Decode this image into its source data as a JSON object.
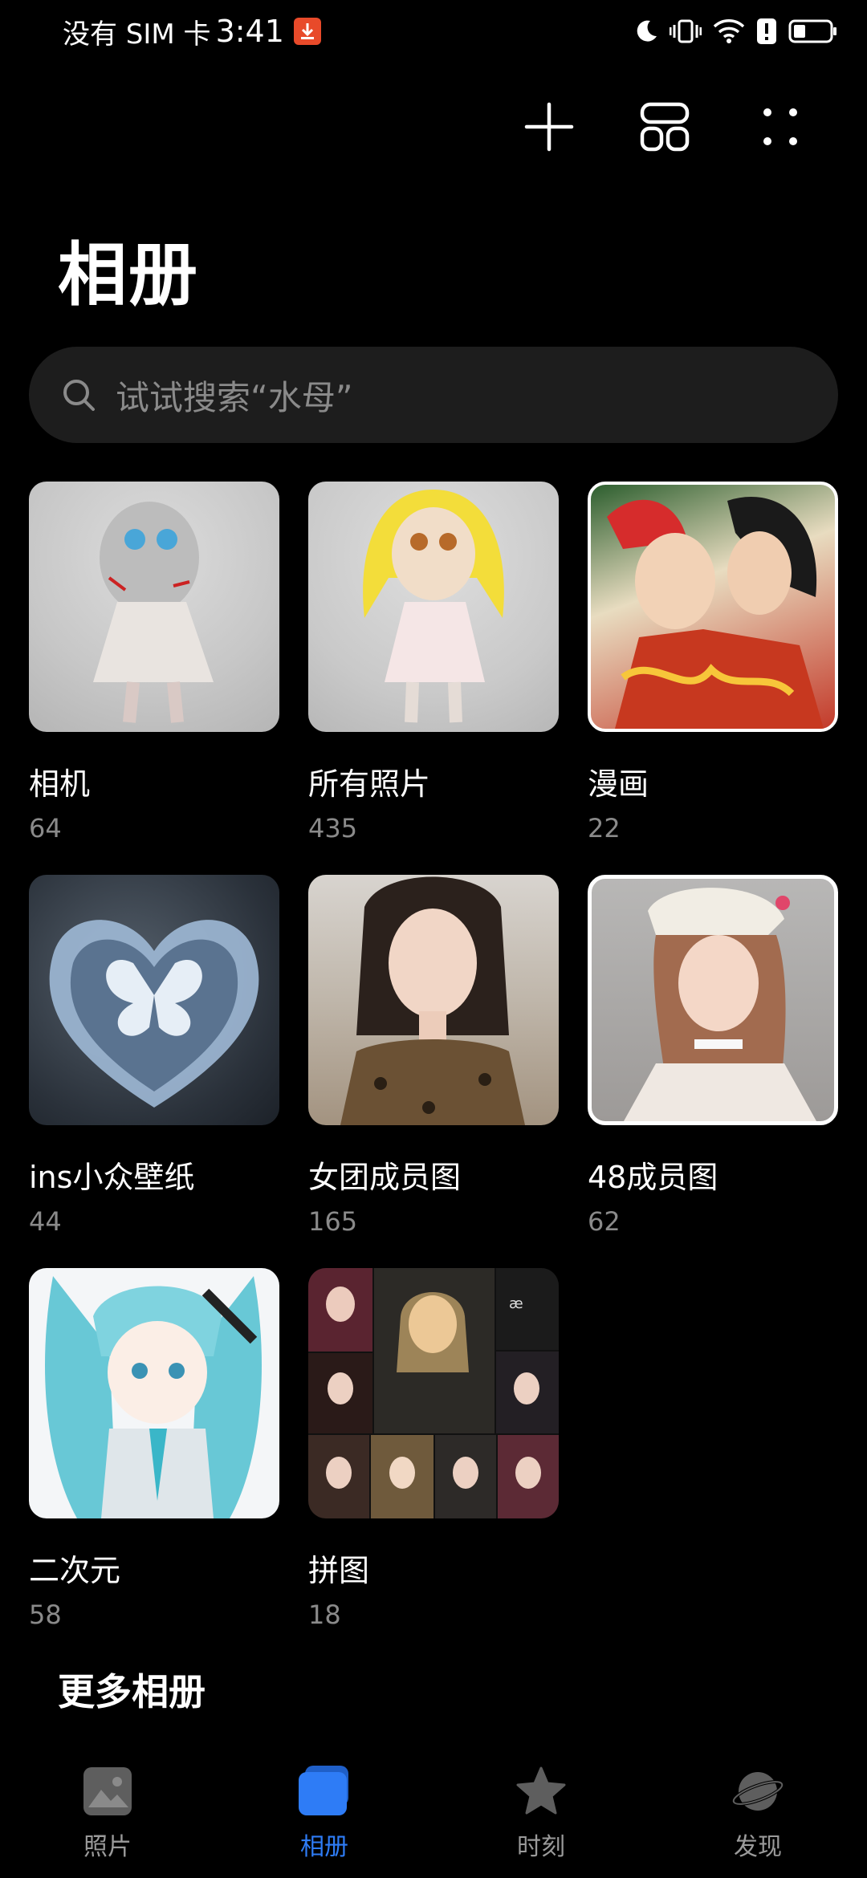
{
  "status_bar": {
    "carrier": "没有 SIM 卡",
    "time": "3:41"
  },
  "header": {
    "title": "相册"
  },
  "search": {
    "placeholder": "试试搜索“水母”"
  },
  "albums": [
    {
      "name": "相机",
      "count": "64"
    },
    {
      "name": "所有照片",
      "count": "435"
    },
    {
      "name": "漫画",
      "count": "22"
    },
    {
      "name": "ins小众壁纸",
      "count": "44"
    },
    {
      "name": "女团成员图",
      "count": "165"
    },
    {
      "name": "48成员图",
      "count": "62"
    },
    {
      "name": "二次元",
      "count": "58"
    },
    {
      "name": "拼图",
      "count": "18"
    }
  ],
  "more_albums": "更多相册",
  "bottom_nav": {
    "items": [
      {
        "label": "照片",
        "icon": "photos-icon",
        "active": false
      },
      {
        "label": "相册",
        "icon": "albums-icon",
        "active": true
      },
      {
        "label": "时刻",
        "icon": "star-icon",
        "active": false
      },
      {
        "label": "发现",
        "icon": "planet-icon",
        "active": false
      }
    ]
  },
  "colors": {
    "accent": "#2e7cf6",
    "background": "#000000",
    "search_bg": "#1d1d1d",
    "secondary_text": "#8a8a8a"
  }
}
